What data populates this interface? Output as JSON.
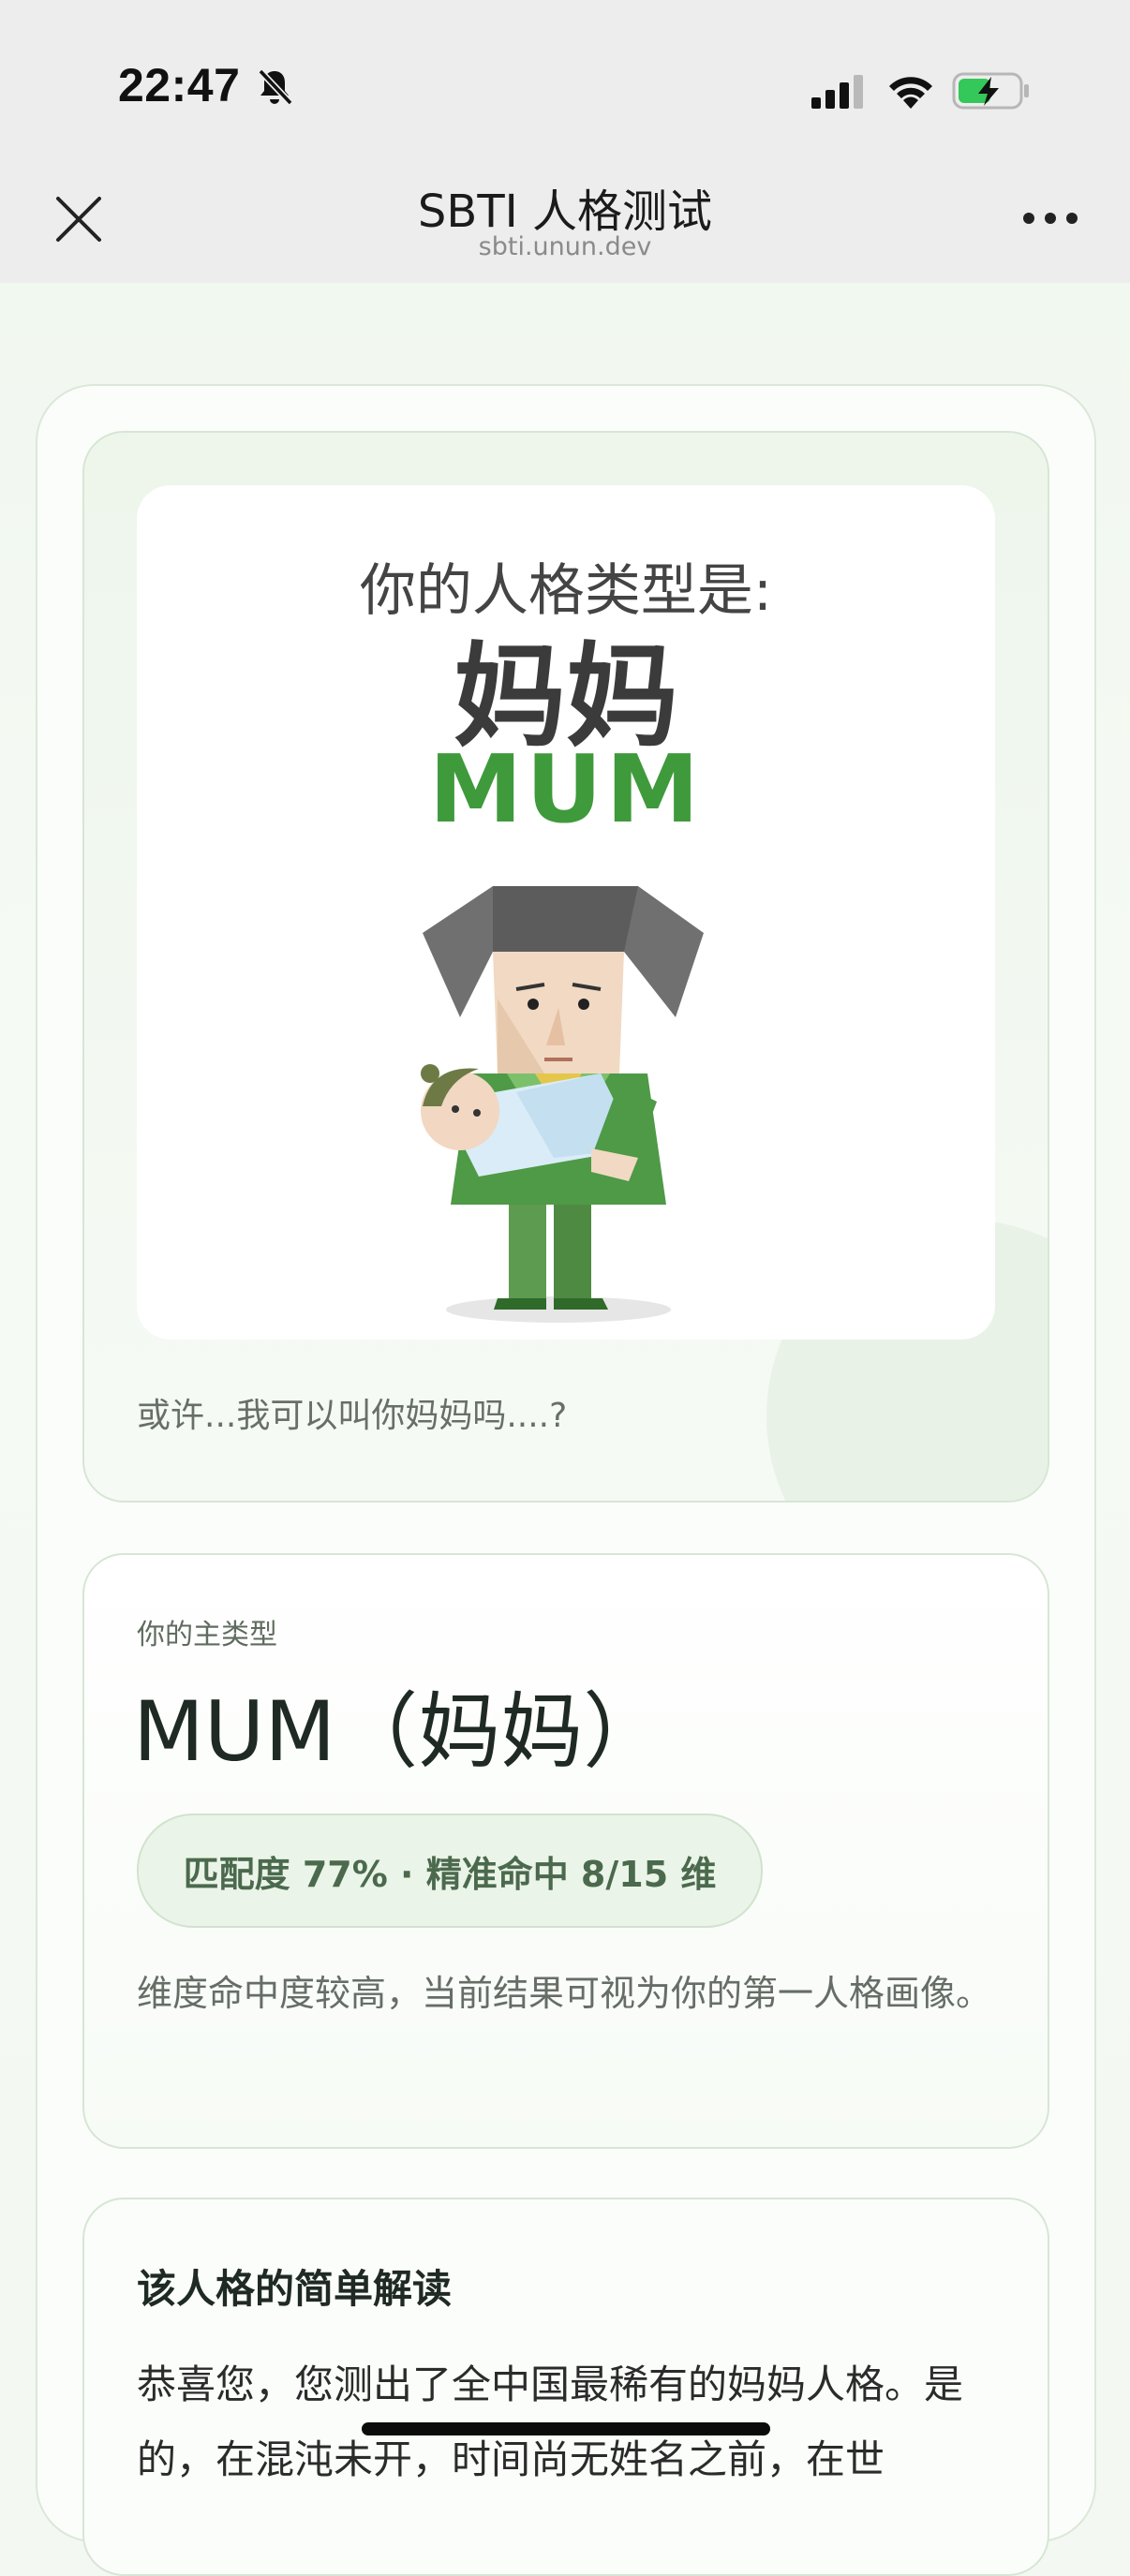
{
  "status_bar": {
    "time": "22:47"
  },
  "nav": {
    "title": "SBTI 人格测试",
    "url": "sbti.unun.dev"
  },
  "hero": {
    "caption": "你的人格类型是:",
    "type_cn": "妈妈",
    "type_code": "MUM",
    "note": "或许...我可以叫你妈妈吗....?"
  },
  "main_card": {
    "label": "你的主类型",
    "type": "MUM（妈妈）",
    "match": "匹配度 77% · 精准命中 8/15 维",
    "description": "维度命中度较高，当前结果可视为你的第一人格画像。"
  },
  "interpretation": {
    "title": "该人格的简单解读",
    "body": "恭喜您，您测出了全中国最稀有的妈妈人格。是的，在混沌未开，时间尚无姓名之前，在世"
  },
  "colors": {
    "accent_green": "#3f9a3c",
    "pill_text": "#4b6a4d"
  }
}
